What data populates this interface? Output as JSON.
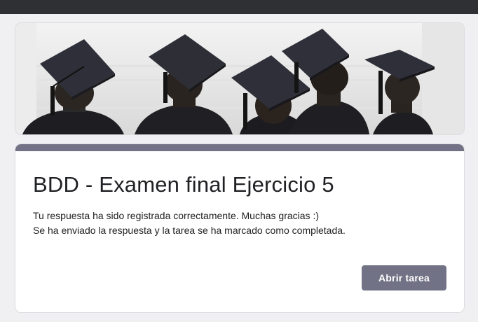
{
  "header": {
    "banner_image": "graduation-caps-banner"
  },
  "form": {
    "title": "BDD - Examen final Ejercicio 5",
    "message_line1": "Tu respuesta ha sido registrada correctamente. Muchas gracias :)",
    "message_line2": "Se ha enviado la respuesta y la tarea se ha marcado como completada.",
    "open_task_button": "Abrir tarea"
  },
  "colors": {
    "accent": "#717285",
    "topbar": "#2f3033",
    "background": "#f0f0f2"
  }
}
